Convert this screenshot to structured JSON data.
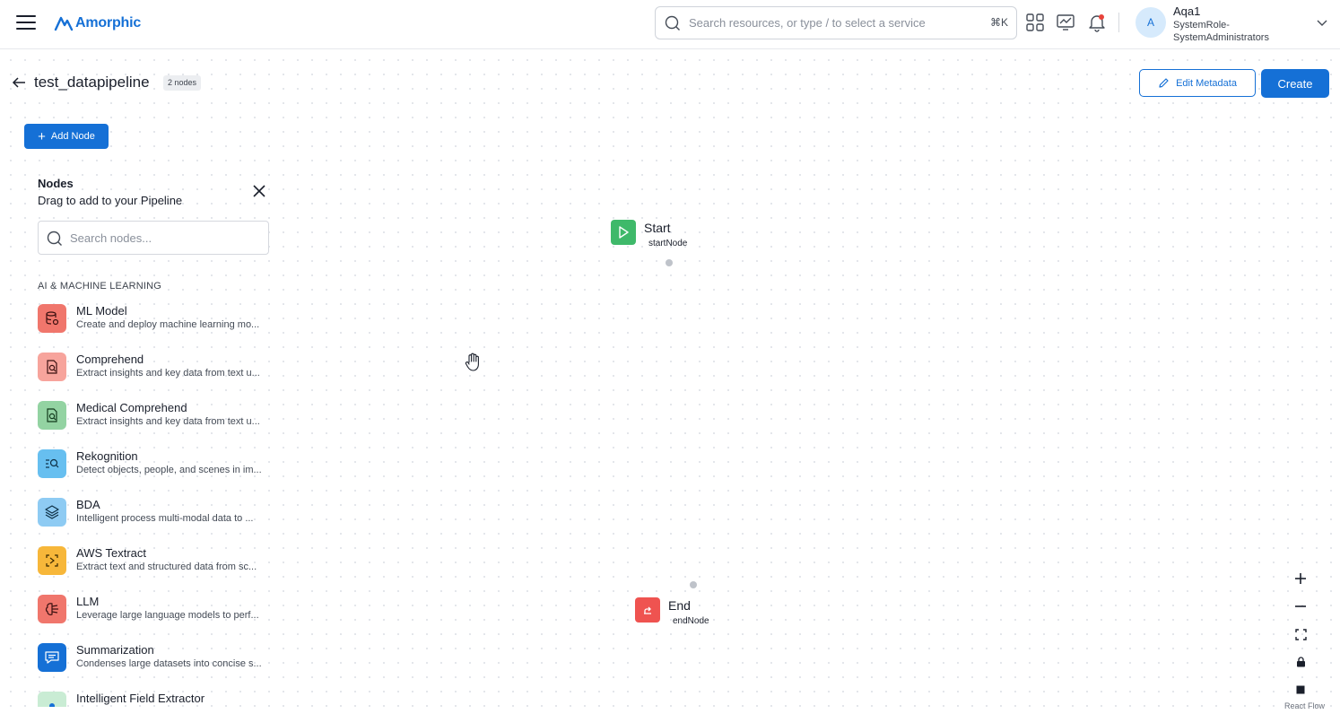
{
  "app": {
    "brand": "Amorphic",
    "search_placeholder": "Search resources, or type / to select a service",
    "search_shortcut": "⌘K",
    "user": {
      "avatar_initial": "A",
      "name": "Aqa1",
      "role": "SystemRole-SystemAdministrators"
    }
  },
  "page": {
    "title": "test_datapipeline",
    "node_count_badge": "2 nodes",
    "edit_metadata_label": "Edit Metadata",
    "create_label": "Create",
    "add_node_label": "Add Node"
  },
  "palette": {
    "title": "Nodes",
    "subtitle": "Drag to add to your Pipeline",
    "search_placeholder": "Search nodes...",
    "section": "AI & MACHINE LEARNING",
    "items": [
      {
        "name": "ML Model",
        "desc": "Create and deploy machine learning mo...",
        "icon": "database-search-icon",
        "color": "#f0766c"
      },
      {
        "name": "Comprehend",
        "desc": "Extract insights and key data from text u...",
        "icon": "document-search-icon",
        "color": "#f7a49c"
      },
      {
        "name": "Medical Comprehend",
        "desc": "Extract insights and key data from text u...",
        "icon": "document-search-icon",
        "color": "#93d3a2"
      },
      {
        "name": "Rekognition",
        "desc": "Detect objects, people, and scenes in im...",
        "icon": "list-search-icon",
        "color": "#67bff0"
      },
      {
        "name": "BDA",
        "desc": "Intelligent process multi-modal data to ...",
        "icon": "layers-icon",
        "color": "#8ecbf3"
      },
      {
        "name": "AWS Textract",
        "desc": "Extract text and structured data from sc...",
        "icon": "scan-text-icon",
        "color": "#f7b73a"
      },
      {
        "name": "LLM",
        "desc": "Leverage large language models to perf...",
        "icon": "brain-icon",
        "color": "#f0766c"
      },
      {
        "name": "Summarization",
        "desc": "Condenses large datasets into concise s...",
        "icon": "chat-summary-icon",
        "color": "#1570d6"
      },
      {
        "name": "Intelligent Field Extractor",
        "desc": "",
        "icon": "field-extract-icon",
        "color": "#c9ecd4"
      }
    ]
  },
  "flow": {
    "start": {
      "label": "Start",
      "id": "startNode",
      "color": "#3fb96a"
    },
    "end": {
      "label": "End",
      "id": "endNode",
      "color": "#ef5350"
    }
  },
  "canvas": {
    "attribution": "React Flow"
  }
}
